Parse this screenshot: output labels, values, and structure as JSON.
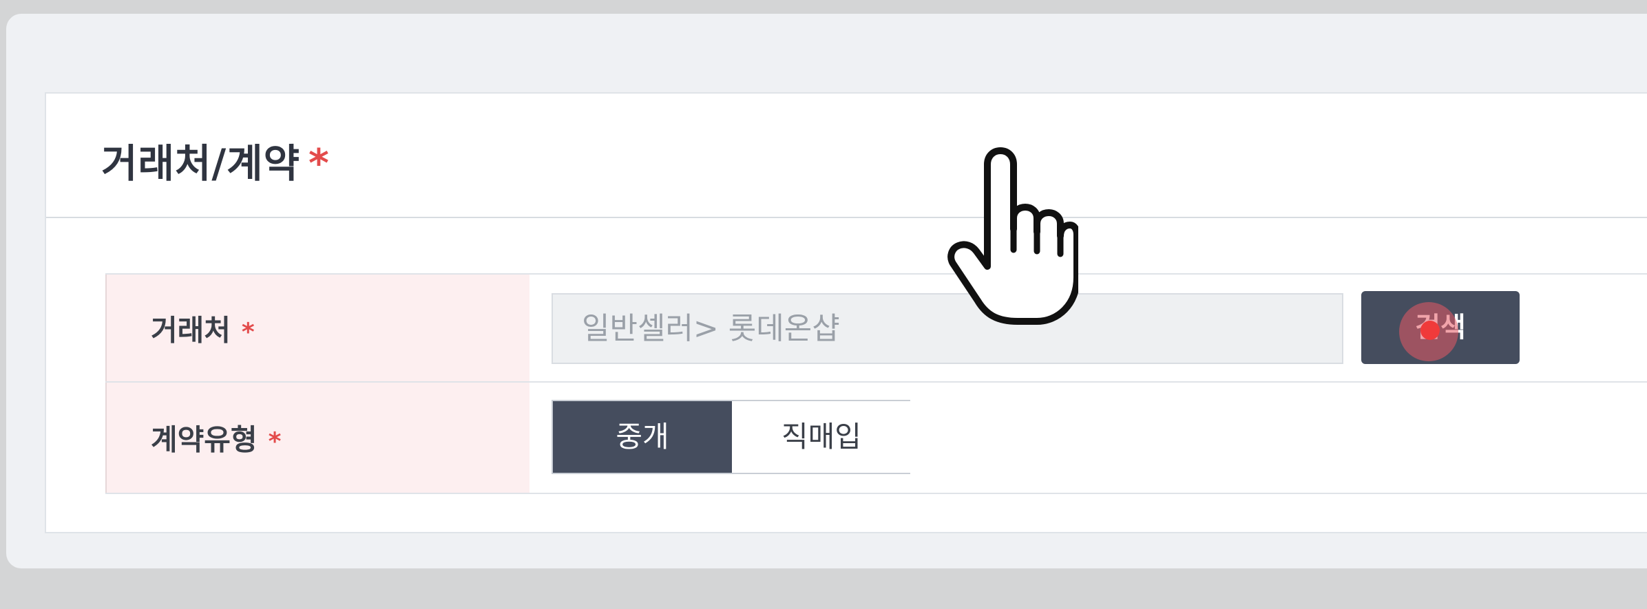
{
  "section": {
    "title": "거래처/계약",
    "required_mark": "*"
  },
  "form": {
    "rows": [
      {
        "label": "거래처",
        "required_mark": "*",
        "input_value": "일반셀러> 롯데온샵",
        "button_label": "검색"
      },
      {
        "label": "계약유형",
        "required_mark": "*",
        "options": [
          "중개",
          "직매입"
        ],
        "selected": "중개"
      }
    ]
  },
  "colors": {
    "accent": "#454d5e",
    "required": "#e34b4b",
    "label_bg": "#fdeff0",
    "click_indicator": "#f03a3a"
  },
  "icons": {
    "cursor": "pointing-hand-icon"
  }
}
